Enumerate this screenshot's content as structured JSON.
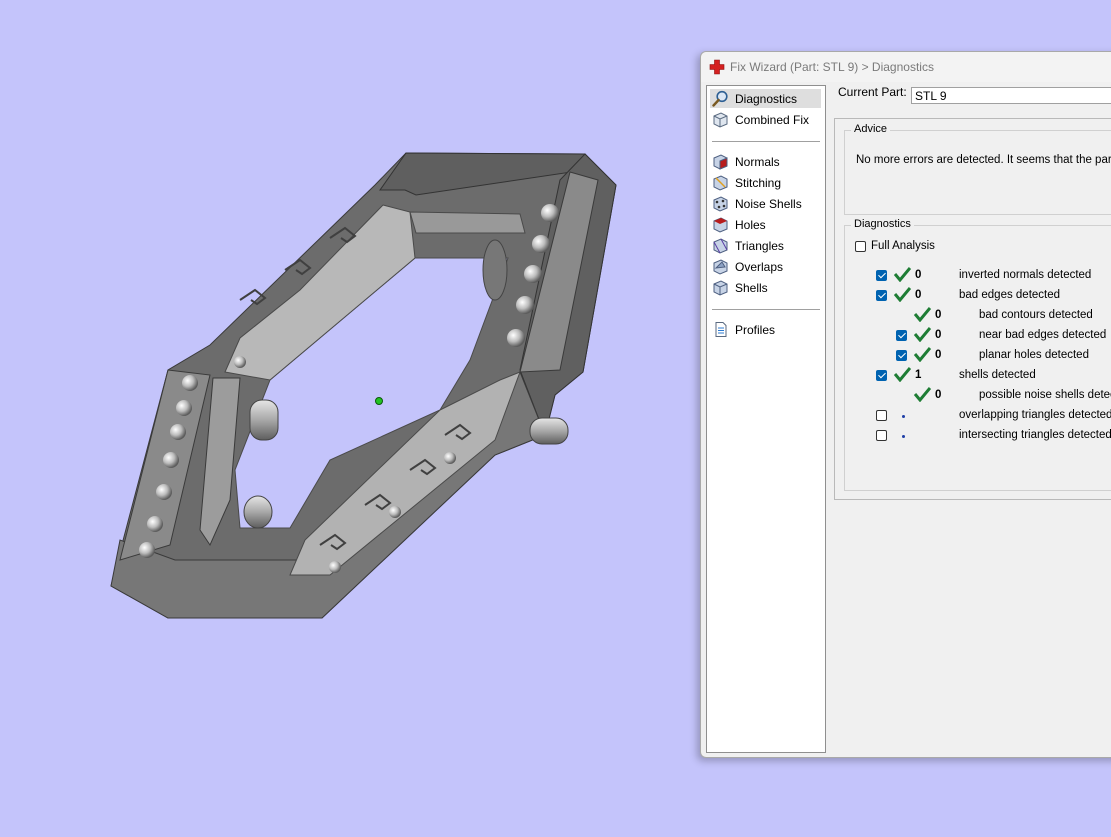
{
  "window": {
    "title": "Fix Wizard (Part: STL 9) > Diagnostics",
    "icon": "red-cross-icon",
    "accent_color": "#d42020"
  },
  "nav": {
    "group1": [
      {
        "label": "Diagnostics",
        "icon": "magnifier-icon",
        "selected": true
      },
      {
        "label": "Combined Fix",
        "icon": "combined-fix-icon",
        "selected": false
      }
    ],
    "group2": [
      {
        "label": "Normals",
        "icon": "normals-cube-icon"
      },
      {
        "label": "Stitching",
        "icon": "stitching-cube-icon"
      },
      {
        "label": "Noise Shells",
        "icon": "noise-shells-icon"
      },
      {
        "label": "Holes",
        "icon": "holes-cube-icon"
      },
      {
        "label": "Triangles",
        "icon": "triangles-cube-icon"
      },
      {
        "label": "Overlaps",
        "icon": "overlaps-cube-icon"
      },
      {
        "label": "Shells",
        "icon": "shells-cube-icon"
      }
    ],
    "group3": [
      {
        "label": "Profiles",
        "icon": "document-icon"
      }
    ]
  },
  "current_part": {
    "label": "Current Part:",
    "value": "STL 9"
  },
  "advice": {
    "title": "Advice",
    "text": "No more errors are detected. It seems that the part i"
  },
  "diagnostics": {
    "title": "Diagnostics",
    "full_analysis": {
      "label": "Full Analysis",
      "checked": false
    },
    "rows": [
      {
        "checked": true,
        "status": "ok",
        "count": "0",
        "label": "inverted normals detected",
        "indent": 0
      },
      {
        "checked": true,
        "status": "ok",
        "count": "0",
        "label": "bad edges detected",
        "indent": 0
      },
      {
        "checked": null,
        "status": "ok",
        "count": "0",
        "label": "bad contours detected",
        "indent": 1
      },
      {
        "checked": true,
        "status": "ok",
        "count": "0",
        "label": "near bad edges detected",
        "indent": 1
      },
      {
        "checked": true,
        "status": "ok",
        "count": "0",
        "label": "planar holes detected",
        "indent": 1
      },
      {
        "checked": true,
        "status": "ok",
        "count": "1",
        "label": "shells detected",
        "indent": 0
      },
      {
        "checked": null,
        "status": "ok",
        "count": "0",
        "label": "possible noise shells detecte",
        "indent": 1
      },
      {
        "checked": false,
        "status": "pending",
        "count": "",
        "label": "overlapping triangles detected",
        "indent": 0
      },
      {
        "checked": false,
        "status": "pending",
        "count": "",
        "label": "intersecting triangles detected",
        "indent": 0
      }
    ],
    "ok_color": "#1e7d34",
    "checkbox_color": "#0063b1"
  },
  "viewport": {
    "background": "#c4c4fb",
    "model_color": "#6e6e6e",
    "pivot_color": "#22c322"
  }
}
